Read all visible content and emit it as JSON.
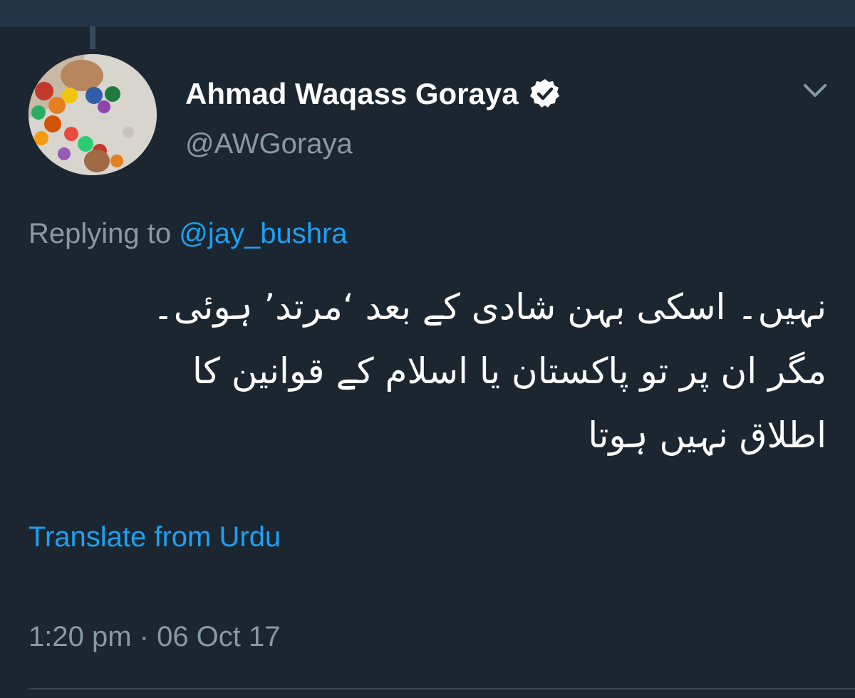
{
  "tweet": {
    "author_name": "Ahmad Waqass Goraya",
    "author_handle": "@AWGoraya",
    "replying_prefix": "Replying to",
    "replying_handle": "@jay_bushra",
    "body_lines": [
      "نہیں۔ اسکی بہن شادی کے بعد ‘مرتد’ ہوئی۔",
      "مگر ان پر تو پاکستان یا اسلام کے قوانین کا",
      "اطلاق نہیں ہوتا"
    ],
    "translate_label": "Translate from Urdu",
    "time": "1:20 pm",
    "separator": " · ",
    "date": "06 Oct 17"
  },
  "icons": {
    "verified": "verified-badge-icon",
    "menu": "chevron-down-icon"
  },
  "colors": {
    "background": "#1b2631",
    "link": "#1da1f2",
    "muted": "#8899a6",
    "text": "#ffffff"
  }
}
